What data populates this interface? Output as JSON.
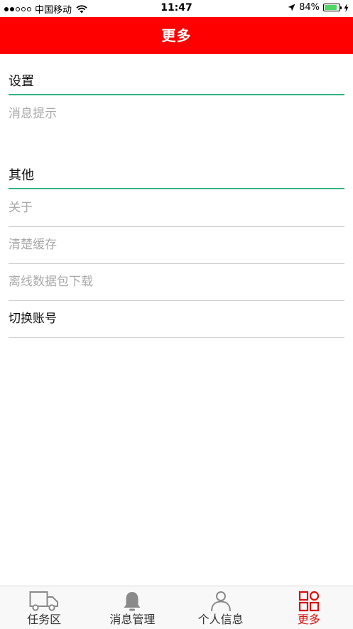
{
  "status_bar": {
    "carrier": "中国移动",
    "time": "11:47",
    "battery_percent": "84%",
    "battery_level": 0.84,
    "icons": [
      "signal-dots-icon",
      "wifi-icon",
      "location-arrow-icon",
      "battery-icon",
      "charging-bolt-icon"
    ]
  },
  "nav": {
    "title": "更多"
  },
  "sections": {
    "settings": {
      "header": "设置",
      "items": [
        {
          "label": "消息提示"
        }
      ]
    },
    "other": {
      "header": "其他",
      "items": [
        {
          "label": "关于"
        },
        {
          "label": "清楚缓存"
        },
        {
          "label": "离线数据包下载"
        },
        {
          "label": "切换账号"
        }
      ]
    }
  },
  "tab_bar": {
    "tabs": [
      {
        "label": "任务区",
        "icon": "truck-icon"
      },
      {
        "label": "消息管理",
        "icon": "bell-icon"
      },
      {
        "label": "个人信息",
        "icon": "person-icon"
      },
      {
        "label": "更多",
        "icon": "grid-icon"
      }
    ],
    "active_color": "#d81010",
    "inactive_color": "#8a8a8a"
  },
  "colors": {
    "nav_background": "#ff0000",
    "section_underline": "#2fb37d"
  }
}
